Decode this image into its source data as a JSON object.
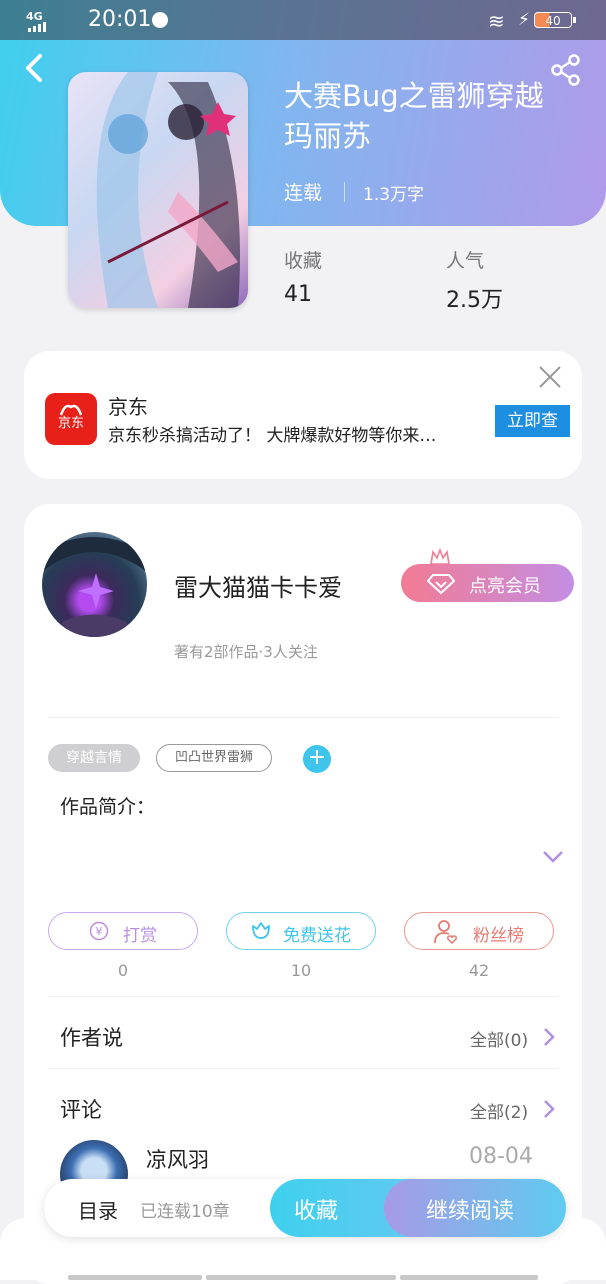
{
  "status_bar": {
    "network": "4G",
    "time": "20:01",
    "battery": "40"
  },
  "book": {
    "title": "大赛Bug之雷狮穿越玛丽苏",
    "status": "连载",
    "word_count": "1.3万字",
    "stats": [
      {
        "label": "收藏",
        "value": "41"
      },
      {
        "label": "人气",
        "value": "2.5万"
      }
    ]
  },
  "ad": {
    "logo_text": "京东",
    "name": "京东",
    "description": "京东秒杀搞活动了！ 大牌爆款好物等你来…",
    "button": "立即查"
  },
  "author": {
    "name": "雷大猫猫卡卡爱",
    "meta": "著有2部作品·3人关注",
    "vip_button": "点亮会员"
  },
  "tags": [
    "穿越言情",
    "凹凸世界雷狮"
  ],
  "tag_add": "+",
  "intro": {
    "label": "作品简介："
  },
  "actions": [
    {
      "label": "打赏",
      "count": "0",
      "color": "#b98fe0"
    },
    {
      "label": "免费送花",
      "count": "10",
      "color": "#3fc4ec"
    },
    {
      "label": "粉丝榜",
      "count": "42",
      "color": "#e57b70"
    }
  ],
  "sections": {
    "author_says": {
      "title": "作者说",
      "all": "全部(0)"
    },
    "comments": {
      "title": "评论",
      "all": "全部(2)"
    }
  },
  "comment": {
    "user": "凉风羽",
    "date": "08-04"
  },
  "bottom_bar": {
    "toc": "目录",
    "toc_meta": "已连载10章",
    "favorite": "收藏",
    "continue": "继续阅读"
  }
}
